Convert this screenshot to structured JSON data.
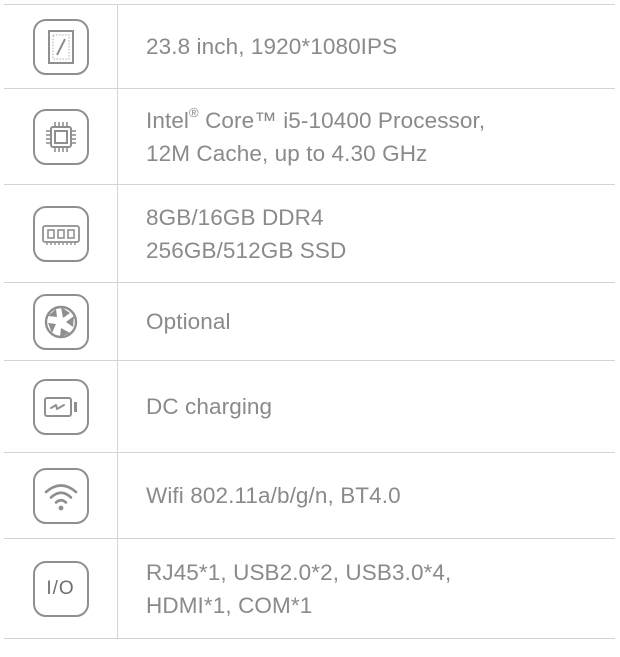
{
  "specs": [
    {
      "icon": "screen-icon",
      "lines": [
        "23.8 inch, 1920*1080IPS"
      ]
    },
    {
      "icon": "cpu-icon",
      "line1_prefix": "Intel",
      "line1_sup": "®",
      "line1_suffix": " Core™ i5-10400 Processor,",
      "line2": "12M Cache, up to 4.30 GHz"
    },
    {
      "icon": "memory-icon",
      "lines": [
        "8GB/16GB DDR4",
        "256GB/512GB SSD"
      ]
    },
    {
      "icon": "camera-shutter-icon",
      "lines": [
        "Optional"
      ]
    },
    {
      "icon": "battery-charging-icon",
      "lines": [
        "DC charging"
      ]
    },
    {
      "icon": "wifi-icon",
      "lines": [
        "Wifi 802.11a/b/g/n, BT4.0"
      ]
    },
    {
      "icon": "io-icon",
      "icon_text": "I/O",
      "lines": [
        "RJ45*1, USB2.0*2, USB3.0*4,",
        "HDMI*1, COM*1"
      ]
    }
  ],
  "colors": {
    "border": "#d4d4d4",
    "text": "#8a8a8a",
    "icon": "#8f8f8f"
  }
}
